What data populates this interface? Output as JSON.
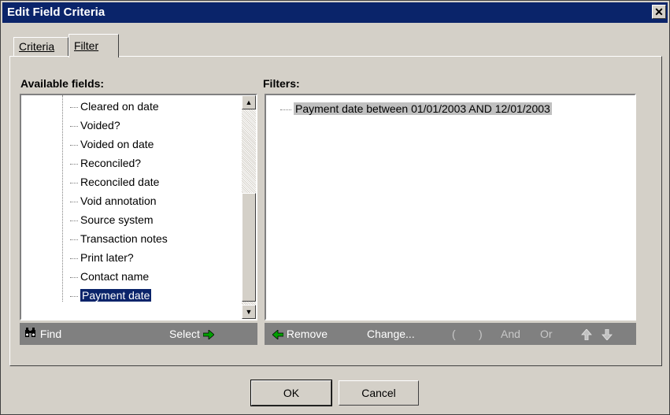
{
  "window": {
    "title": "Edit Field Criteria",
    "close_glyph": "✕"
  },
  "tabs": [
    {
      "label": "Criteria",
      "active": false
    },
    {
      "label": "Filter",
      "active": true
    }
  ],
  "available": {
    "label": "Available fields:",
    "items": [
      "Cleared on date",
      "Voided?",
      "Voided on date",
      "Reconciled?",
      "Reconciled date",
      "Void annotation",
      "Source system",
      "Transaction notes",
      "Print later?",
      "Contact name",
      "Payment date"
    ],
    "selected_index": 10
  },
  "filters": {
    "label": "Filters:",
    "items": [
      "Payment date between 01/01/2003 AND 12/01/2003"
    ]
  },
  "left_toolbar": {
    "find": "Find",
    "select": "Select"
  },
  "right_toolbar": {
    "remove": "Remove",
    "change": "Change...",
    "open_paren": "(",
    "close_paren": ")",
    "and": "And",
    "or": "Or"
  },
  "buttons": {
    "ok": "OK",
    "cancel": "Cancel"
  },
  "icons": {
    "find": "binoculars-icon",
    "select": "arrow-right-icon",
    "remove": "arrow-left-icon",
    "up": "arrow-up-icon",
    "down": "arrow-down-icon"
  },
  "colors": {
    "title_bar": "#0a246a",
    "dialog_bg": "#d4d0c8",
    "toolbar_bg": "#808080",
    "accent_arrow": "#008000"
  }
}
